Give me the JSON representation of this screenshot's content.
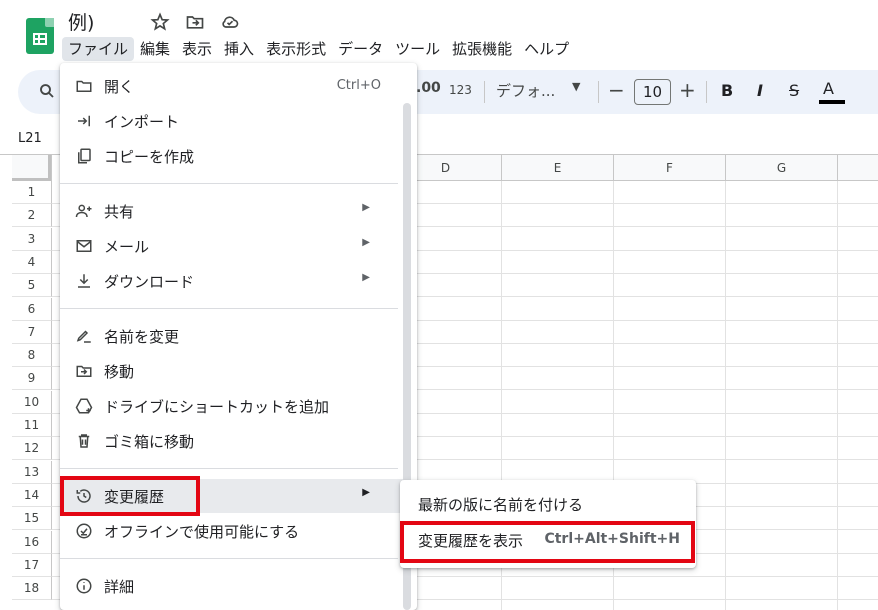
{
  "header": {
    "title": "例)",
    "icons": [
      "star-icon",
      "move-folder-icon",
      "cloud-status-icon"
    ]
  },
  "menubar": [
    "ファイル",
    "編集",
    "表示",
    "挿入",
    "表示形式",
    "データ",
    "ツール",
    "拡張機能",
    "ヘルプ"
  ],
  "toolbar": {
    "decimal_label": ".00",
    "number_format_label": "123",
    "font_name": "デフォ...",
    "font_size": "10",
    "bold": "B",
    "italic": "I",
    "strike": "S",
    "text_color": "A",
    "text_color_value": "#000000"
  },
  "namebox": "L21",
  "grid": {
    "columns": [
      "D",
      "E",
      "F",
      "G"
    ],
    "rows": [
      "1",
      "2",
      "3",
      "4",
      "5",
      "6",
      "7",
      "8",
      "9",
      "10",
      "11",
      "12",
      "13",
      "14",
      "15",
      "16",
      "17",
      "18"
    ]
  },
  "file_menu": {
    "items": [
      {
        "label": "開く",
        "shortcut": "Ctrl+O",
        "icon": "folder-icon"
      },
      {
        "label": "インポート",
        "icon": "import-icon"
      },
      {
        "label": "コピーを作成",
        "icon": "copy-icon"
      },
      {
        "label": "共有",
        "icon": "person-add-icon",
        "submenu": true
      },
      {
        "label": "メール",
        "icon": "mail-icon",
        "submenu": true
      },
      {
        "label": "ダウンロード",
        "icon": "download-icon",
        "submenu": true
      },
      {
        "label": "名前を変更",
        "icon": "rename-icon"
      },
      {
        "label": "移動",
        "icon": "move-icon"
      },
      {
        "label": "ドライブにショートカットを追加",
        "icon": "drive-shortcut-icon"
      },
      {
        "label": "ゴミ箱に移動",
        "icon": "trash-icon"
      },
      {
        "label": "変更履歴",
        "icon": "history-icon",
        "submenu": true
      },
      {
        "label": "オフラインで使用可能にする",
        "icon": "offline-icon"
      },
      {
        "label": "詳細",
        "icon": "info-icon"
      }
    ]
  },
  "version_submenu": {
    "items": [
      {
        "label": "最新の版に名前を付ける"
      },
      {
        "label": "変更履歴を表示",
        "shortcut": "Ctrl+Alt+Shift+H"
      }
    ]
  },
  "highlight_color": "#e30613"
}
